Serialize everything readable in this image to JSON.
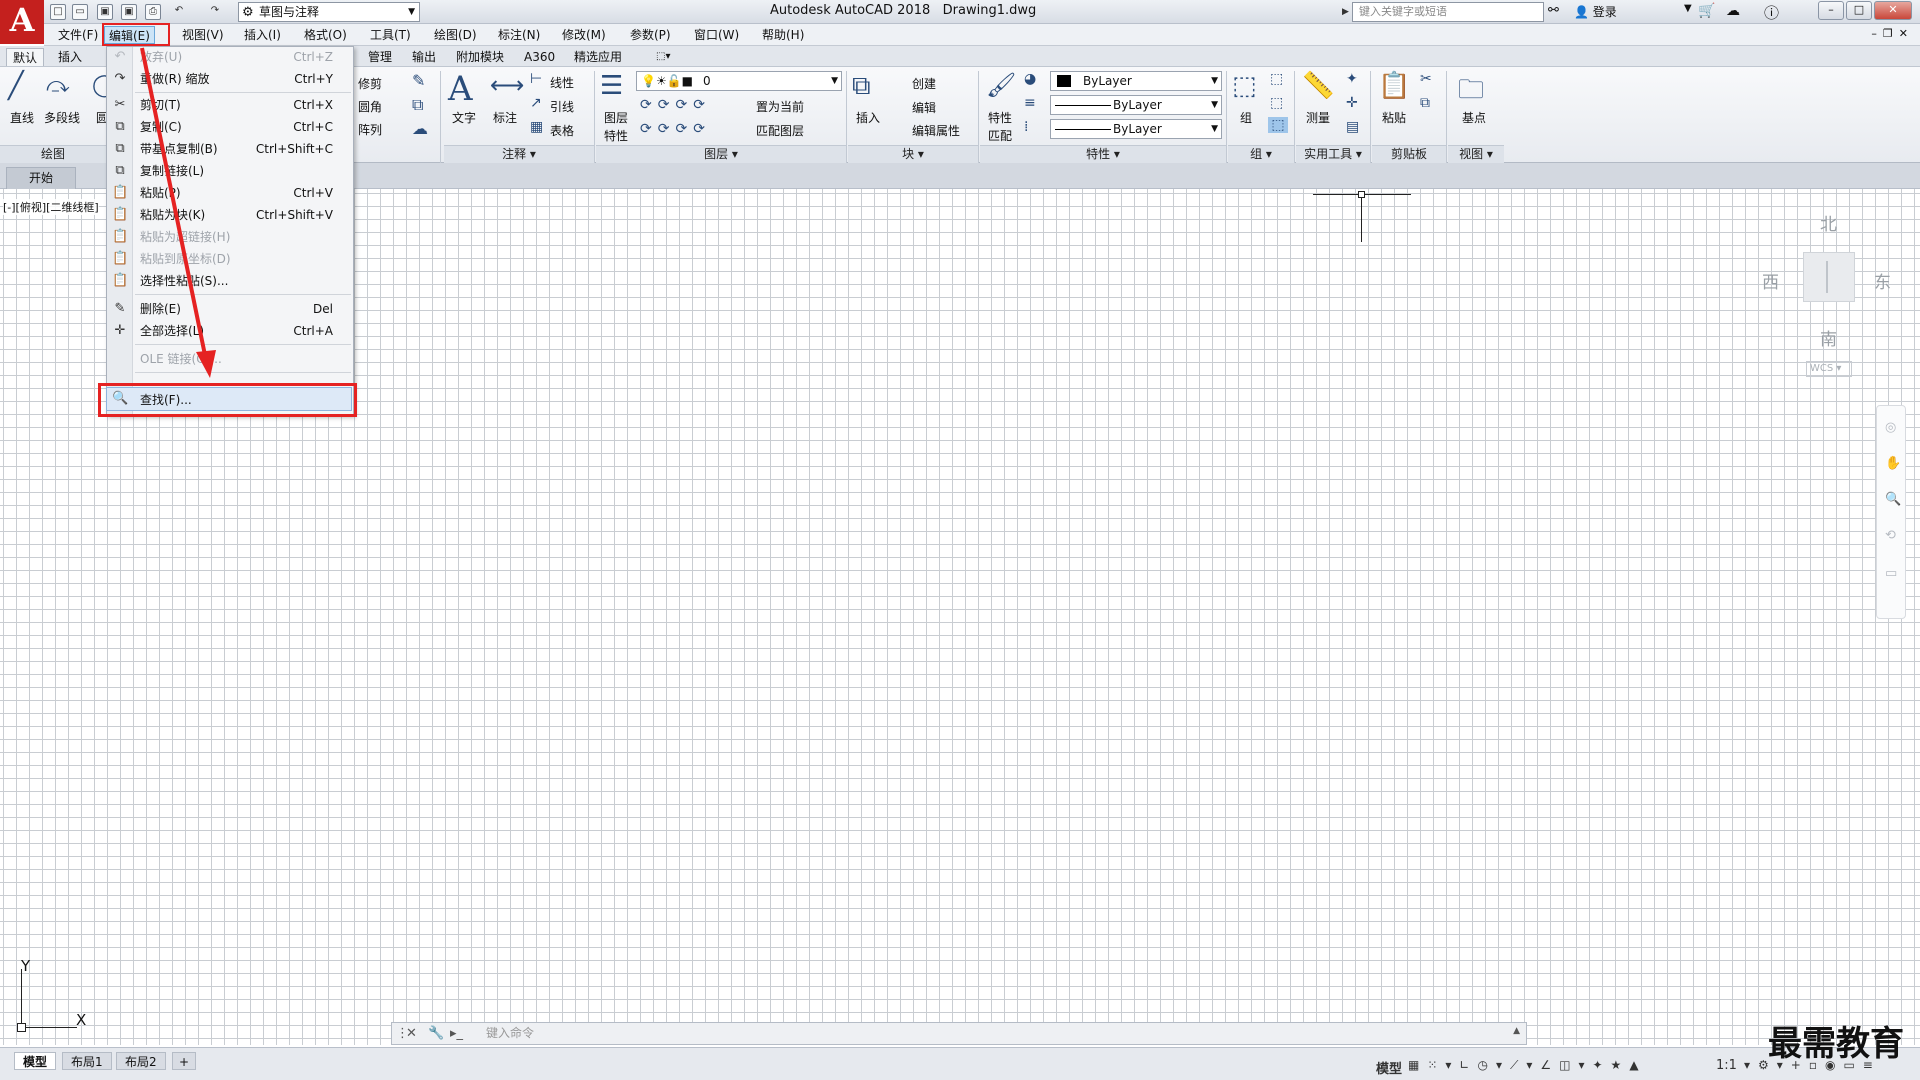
{
  "title_bar": {
    "app_logo": "A",
    "workspace": "草图与注释",
    "app_title": "Autodesk AutoCAD 2018",
    "drawing_name": "Drawing1.dwg",
    "search_placeholder": "键入关键字或短语",
    "login": "登录",
    "quick_access_icons": [
      "new-icon",
      "open-icon",
      "save-icon",
      "saveas-icon",
      "print-icon",
      "undo-icon",
      "redo-icon"
    ]
  },
  "menubar": {
    "items": [
      "文件(F)",
      "编辑(E)",
      "视图(V)",
      "插入(I)",
      "格式(O)",
      "工具(T)",
      "绘图(D)",
      "标注(N)",
      "修改(M)",
      "参数(P)",
      "窗口(W)",
      "帮助(H)"
    ],
    "active_index": 1
  },
  "ribbon_tabs": {
    "items": [
      "默认",
      "插入",
      "管理",
      "输出",
      "附加模块",
      "A360",
      "精选应用"
    ],
    "active_index": 0
  },
  "ribbon": {
    "draw": {
      "line": "直线",
      "polyline": "多段线",
      "circle_short": "圆",
      "panel": "绘图"
    },
    "modify": {
      "trim": "修剪",
      "fillet": "圆角",
      "array": "阵列"
    },
    "annotation": {
      "text": "文字",
      "dimension": "标注",
      "linear": "线性",
      "leader": "引线",
      "table": "表格",
      "panel": "注释"
    },
    "layers": {
      "layer_props_1": "图层",
      "layer_props_2": "特性",
      "layer_value": "0",
      "set_current": "置为当前",
      "match_layer": "匹配图层",
      "panel": "图层"
    },
    "block": {
      "insert": "插入",
      "create": "创建",
      "edit": "编辑",
      "edit_attr": "编辑属性",
      "panel": "块"
    },
    "properties": {
      "match_1": "特性",
      "match_2": "匹配",
      "color": "ByLayer",
      "linetype": "ByLayer",
      "lineweight": "ByLayer",
      "panel": "特性"
    },
    "groups": {
      "group": "组",
      "panel": "组"
    },
    "utilities": {
      "measure": "测量",
      "panel": "实用工具"
    },
    "clipboard": {
      "paste": "粘贴",
      "panel": "剪贴板"
    },
    "view": {
      "base": "基点",
      "panel": "视图"
    }
  },
  "file_tabs": {
    "start": "开始"
  },
  "viewport": {
    "label": "[-][俯视][二维线框]"
  },
  "viewcube": {
    "north": "北",
    "south": "南",
    "east": "东",
    "west": "西",
    "wcs": "WCS"
  },
  "ucs": {
    "x": "X",
    "y": "Y"
  },
  "edit_menu": {
    "items": [
      {
        "icon": "undo-icon",
        "label": "放弃(U)",
        "shortcut": "Ctrl+Z",
        "disabled": true
      },
      {
        "icon": "redo-icon",
        "label": "重做(R) 缩放",
        "shortcut": "Ctrl+Y",
        "disabled": false
      },
      {
        "icon": "scissors-icon",
        "label": "剪切(T)",
        "shortcut": "Ctrl+X",
        "disabled": false
      },
      {
        "icon": "copy-icon",
        "label": "复制(C)",
        "shortcut": "Ctrl+C",
        "disabled": false
      },
      {
        "icon": "copy-base-icon",
        "label": "带基点复制(B)",
        "shortcut": "Ctrl+Shift+C",
        "disabled": false
      },
      {
        "icon": "copy-link-icon",
        "label": "复制链接(L)",
        "shortcut": "",
        "disabled": false
      },
      {
        "icon": "paste-icon",
        "label": "粘贴(P)",
        "shortcut": "Ctrl+V",
        "disabled": false
      },
      {
        "icon": "paste-block-icon",
        "label": "粘贴为块(K)",
        "shortcut": "Ctrl+Shift+V",
        "disabled": false
      },
      {
        "icon": "paste-link-icon",
        "label": "粘贴为超链接(H)",
        "shortcut": "",
        "disabled": true
      },
      {
        "icon": "paste-coords-icon",
        "label": "粘贴到原坐标(D)",
        "shortcut": "",
        "disabled": true
      },
      {
        "icon": "paste-special-icon",
        "label": "选择性粘贴(S)...",
        "shortcut": "",
        "disabled": false
      },
      {
        "icon": "erase-icon",
        "label": "删除(E)",
        "shortcut": "Del",
        "disabled": false
      },
      {
        "icon": "select-all-icon",
        "label": "全部选择(L)",
        "shortcut": "Ctrl+A",
        "disabled": false
      },
      {
        "icon": "",
        "label": "OLE 链接(O)...",
        "shortcut": "",
        "disabled": true
      },
      {
        "icon": "find-icon",
        "label": "查找(F)...",
        "shortcut": "",
        "disabled": false
      }
    ]
  },
  "command_line": {
    "placeholder": "键入命令"
  },
  "status_bar": {
    "layout_tabs": [
      "模型",
      "布局1",
      "布局2"
    ],
    "model_label": "模型",
    "scale": "1:1"
  },
  "watermark": "最需教育",
  "annotation_color": "#e52222"
}
